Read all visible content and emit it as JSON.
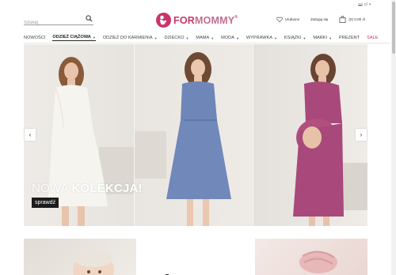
{
  "lang": {
    "code": "pl"
  },
  "search": {
    "placeholder": "Szukaj"
  },
  "logo": {
    "part1": "FOR",
    "part2": "MOMMY",
    "reg": "®"
  },
  "header": {
    "favorites_label": "Ulubione",
    "login_label": "Zaloguj się",
    "cart_label": "(0) 0,00 zł"
  },
  "nav": {
    "items": [
      {
        "label": "Nowości"
      },
      {
        "label": "Odzież ciążowa"
      },
      {
        "label": "Odzież do karmienia"
      },
      {
        "label": "Dziecko"
      },
      {
        "label": "Mama"
      },
      {
        "label": "Moda"
      },
      {
        "label": "Wyprawka"
      },
      {
        "label": "Książki"
      },
      {
        "label": "Marki"
      },
      {
        "label": "Prezent"
      },
      {
        "label": "Sale"
      }
    ]
  },
  "hero": {
    "slogan_light": "NOWA ",
    "slogan_bold": "KOLEKCJA!",
    "cta_label": "sprawdź"
  },
  "colors": {
    "brand": "#c9356a",
    "dress_white": "#f6f4ef",
    "dress_blue": "#6f86b9",
    "dress_plum": "#a9487a"
  }
}
